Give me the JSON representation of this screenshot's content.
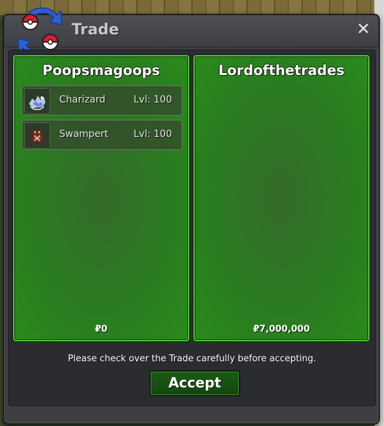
{
  "window": {
    "title": "Trade",
    "close_label": "✕"
  },
  "left_panel": {
    "player": "Poopsmagoops",
    "items": [
      {
        "name": "Charizard",
        "level": "Lvl: 100"
      },
      {
        "name": "Swampert",
        "level": "Lvl: 100"
      }
    ],
    "money": "₽0"
  },
  "right_panel": {
    "player": "Lordofthetrades",
    "items": [],
    "money": "₽7,000,000"
  },
  "notice": "Please check over the Trade carefully before accepting.",
  "accept_label": "Accept",
  "colors": {
    "panel_green": "#2a8a1c",
    "panel_border": "#4fc43a",
    "window_bg": "#3f3f43",
    "accept_bg": "#1d5a16"
  },
  "icons": {
    "logo": "trade-arrows-pokeball-icon",
    "close": "close-icon"
  }
}
